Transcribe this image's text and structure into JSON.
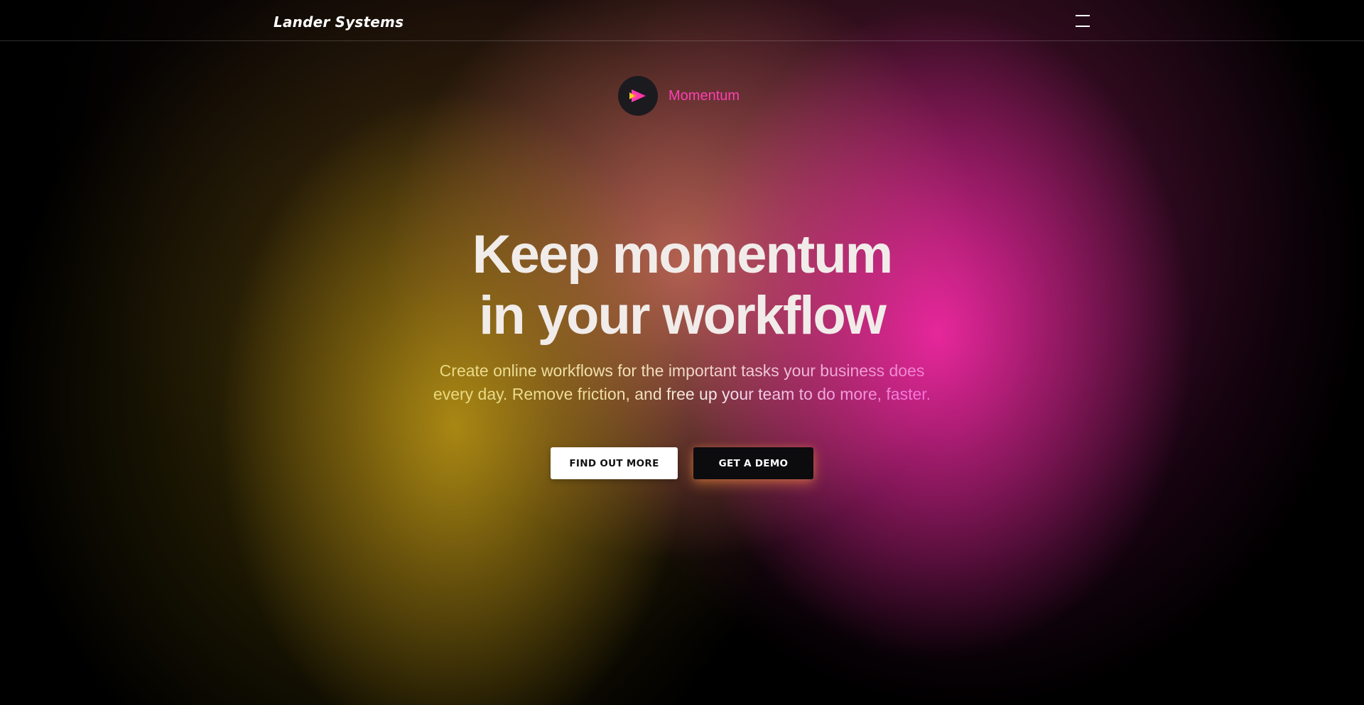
{
  "header": {
    "brand": "Lander Systems",
    "menu_icon": "hamburger-menu-icon"
  },
  "product": {
    "logo_icon": "play-arrow-icon",
    "name": "Momentum"
  },
  "hero": {
    "headline_line1": "Keep momentum",
    "headline_line2": "in your workflow",
    "subtext_line1": "Create online workflows for the important tasks your business does",
    "subtext_line2": "every day. Remove friction, and free up your team to do more, faster."
  },
  "actions": {
    "primary_label": "FIND OUT MORE",
    "secondary_label": "GET A DEMO"
  },
  "colors": {
    "accent_pink": "#ff3fb4",
    "accent_yellow": "#e9d874",
    "background": "#000000"
  }
}
